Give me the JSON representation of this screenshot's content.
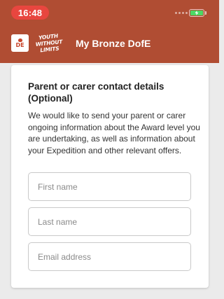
{
  "status_bar": {
    "time": "16:48",
    "time_pill_color": "#e8463f",
    "battery_icon": "battery-charging-icon"
  },
  "header": {
    "background_color": "#b04d33",
    "logo_text": "DE",
    "slogan": "YOUTH WITHOUT LIMITS",
    "title": "My Bronze DofE"
  },
  "card": {
    "title": "Parent or carer contact details (Optional)",
    "description": "We would like to send your parent or carer ongoing information about the Award level you are undertaking, as well as information about your Expedition and other relevant offers."
  },
  "form": {
    "first_name": {
      "placeholder": "First name",
      "value": ""
    },
    "last_name": {
      "placeholder": "Last name",
      "value": ""
    },
    "email": {
      "placeholder": "Email address",
      "value": ""
    }
  }
}
